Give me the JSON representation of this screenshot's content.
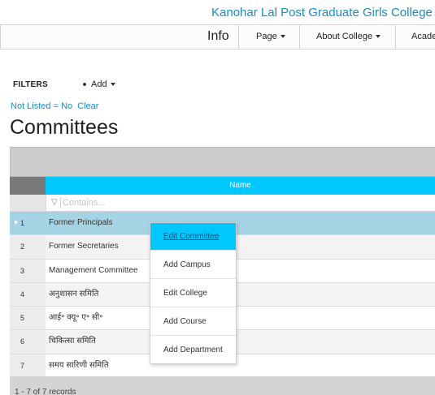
{
  "header": {
    "college_name": "Kanohar Lal Post Graduate Girls College"
  },
  "nav": {
    "info": "Info",
    "items": [
      {
        "label": "Page"
      },
      {
        "label": "About College"
      },
      {
        "label": "Acade"
      }
    ]
  },
  "toolbar": {
    "filters_label": "FILTERS",
    "add_label": "Add",
    "filter_summary": "Not Listed = No",
    "clear_label": "Clear"
  },
  "page": {
    "title": "Committees"
  },
  "grid": {
    "column_name": "Name",
    "filter_placeholder": "Contains...",
    "rows": [
      {
        "num": "1",
        "name": "Former Principals"
      },
      {
        "num": "2",
        "name": "Former Secretaries"
      },
      {
        "num": "3",
        "name": "Management Committee"
      },
      {
        "num": "4",
        "name": "अनुशासन समिति"
      },
      {
        "num": "5",
        "name": "आई॰ क्यू॰ ए॰ सी॰"
      },
      {
        "num": "6",
        "name": "चिकित्सा समिति"
      },
      {
        "num": "7",
        "name": "समय सारिणी समिति"
      }
    ],
    "selected_row": "1",
    "footer_text": "1 - 7 of 7 records"
  },
  "context_menu": {
    "items": [
      {
        "label": "Edit Committee"
      },
      {
        "label": "Add Campus"
      },
      {
        "label": "Edit College"
      },
      {
        "label": "Add Course"
      },
      {
        "label": "Add Department"
      }
    ],
    "active_item": "Edit Committee"
  },
  "colors": {
    "accent": "#00c8ff",
    "link": "#1a8cc7",
    "selected_row": "#a6d3e3"
  }
}
